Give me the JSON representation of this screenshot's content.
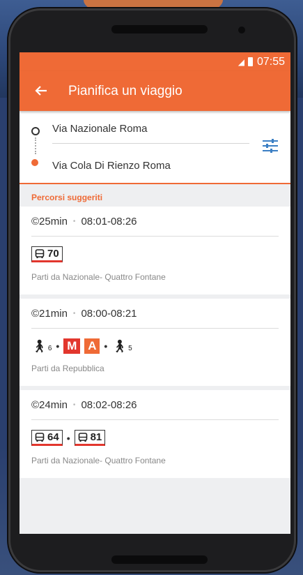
{
  "statusbar": {
    "time": "07:55"
  },
  "appbar": {
    "back_icon": "arrow-left-icon",
    "title": "Pianifica un viaggio"
  },
  "route": {
    "from": "Via Nazionale Roma",
    "to": "Via Cola Di Rienzo Roma",
    "settings_icon": "tune-sliders-icon"
  },
  "section_label": "Percorsi suggeriti",
  "routes": [
    {
      "duration": "©25min",
      "times": "08:01-08:26",
      "lines": [
        "70"
      ],
      "depart": "Parti da Nazionale- Quattro Fontane"
    },
    {
      "duration": "©21min",
      "times": "08:00-08:21",
      "walk_before": "6",
      "metro_symbol": "M",
      "metro_line": "A",
      "walk_after": "5",
      "depart": "Parti da Repubblica"
    },
    {
      "duration": "©24min",
      "times": "08:02-08:26",
      "lines": [
        "64",
        "81"
      ],
      "depart": "Parti da Nazionale- Quattro Fontane"
    }
  ],
  "colors": {
    "accent": "#ef6a36",
    "metro_red": "#e2362d"
  }
}
